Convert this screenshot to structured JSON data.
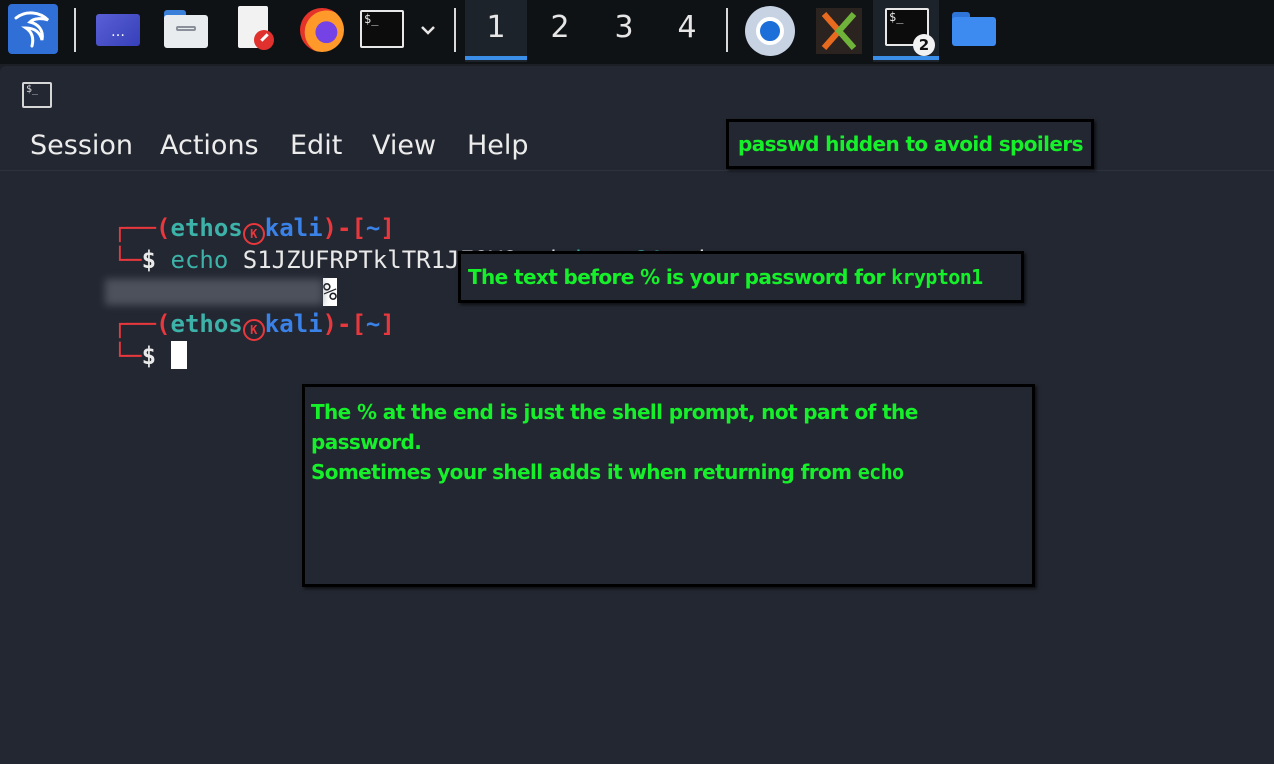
{
  "taskbar": {
    "workspaces": [
      "1",
      "2",
      "3",
      "4"
    ],
    "active_workspace": "1",
    "terminal_badge": "2",
    "terminal_icon_text": "$_"
  },
  "window": {
    "title_icon_text": "$_",
    "menu": [
      "Session",
      "Actions",
      "Edit",
      "View",
      "Help"
    ]
  },
  "terminal": {
    "prompt1": {
      "open": "┌──(",
      "user": "ethos",
      "logo": "K",
      "host": "kali",
      "close": ")-[",
      "dir": "~",
      "end": "]"
    },
    "command": {
      "corner": "└─",
      "dollar": "$ ",
      "cmd": "echo",
      "arg": " S1JZUFRPTklTR1JFQVQ= | ",
      "pipe_cmd": "base64",
      "flag": " -d"
    },
    "output_suffix": "%",
    "prompt2": {
      "open": "┌──(",
      "user": "ethos",
      "logo": "K",
      "host": "kali",
      "close": ")-[",
      "dir": "~",
      "end": "]"
    },
    "prompt2_line": {
      "corner": "└─",
      "dollar": "$ "
    }
  },
  "annotations": {
    "spoiler": "passwd hidden to avoid spoilers",
    "password_note_prefix": "The text before % is your password for ",
    "password_note_user": "krypton1",
    "percent_note_line1": "The % at the end is just the shell prompt, not part of the password.",
    "percent_note_line2_prefix": "Sometimes your shell adds it when returning from ",
    "percent_note_line2_cmd": "echo"
  },
  "colors": {
    "annotation_text": "#16f02a",
    "prompt_red": "#e8383d",
    "prompt_cyan": "#3db2a9",
    "prompt_blue": "#3a82e8",
    "accent": "#3b8ee8"
  },
  "icons": [
    "kali-dragon-icon",
    "show-desktop-icon",
    "file-manager-icon",
    "text-editor-icon",
    "firefox-icon",
    "terminal-icon",
    "chevron-down-icon",
    "chromium-icon",
    "burp-suite-icon",
    "terminal-icon",
    "folder-icon"
  ]
}
